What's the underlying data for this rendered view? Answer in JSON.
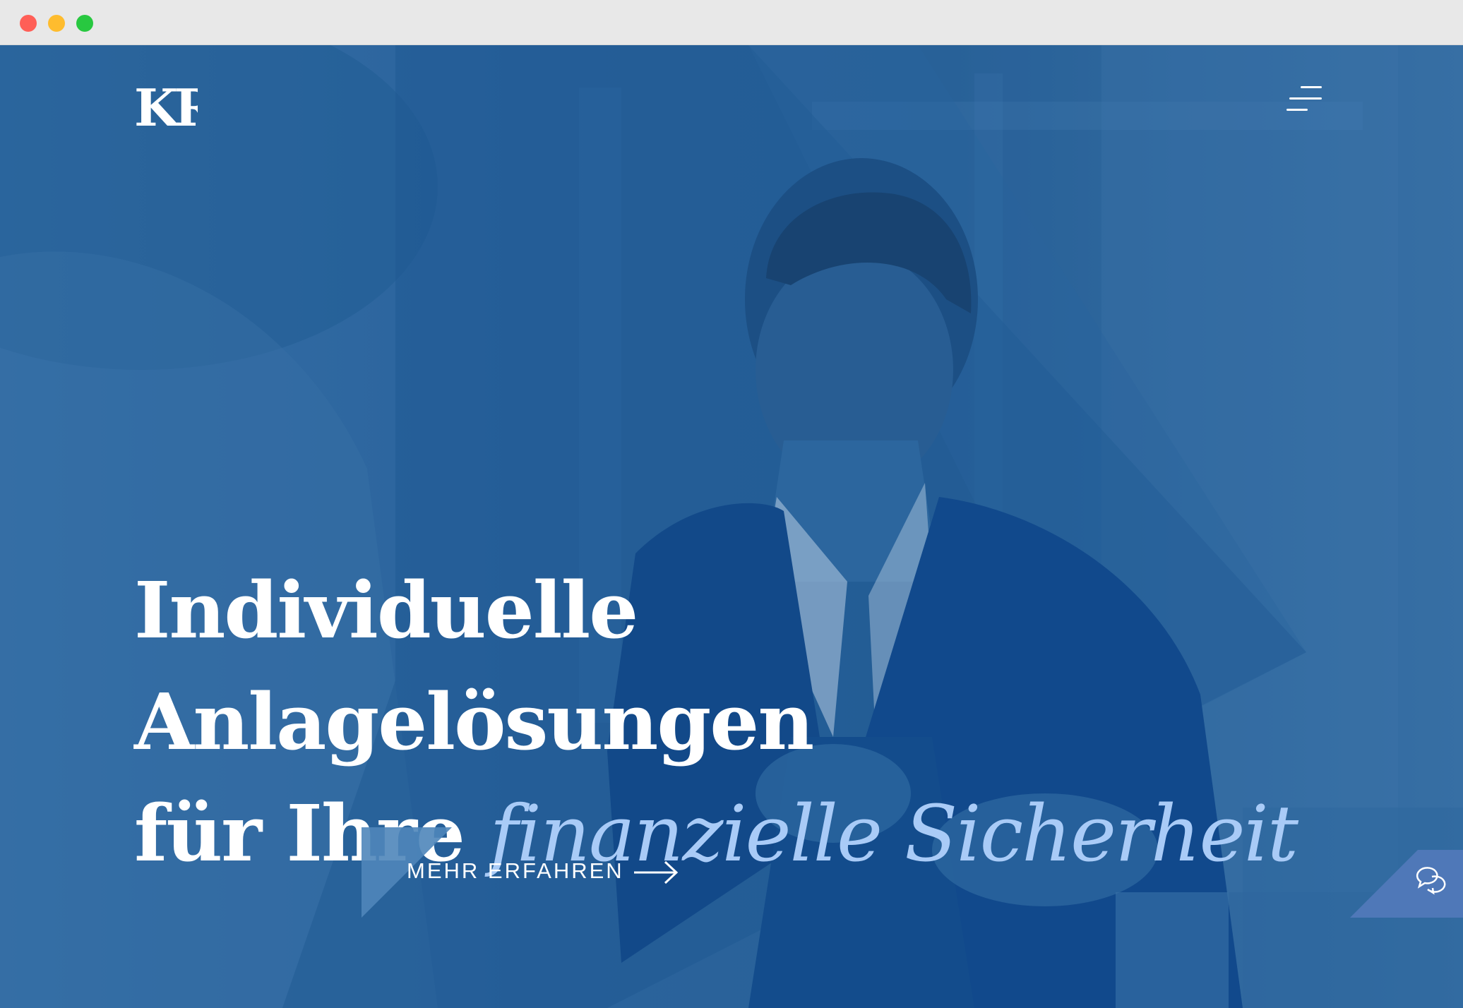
{
  "browser": {
    "window_controls": [
      "close",
      "minimize",
      "maximize"
    ]
  },
  "header": {
    "logo_text": "KR",
    "menu_icon": "menu-icon"
  },
  "hero": {
    "headline_line1": "Individuelle Anlagelösungen",
    "headline_line2_plain": "für Ihre",
    "headline_line2_accent": "finanzielle Sicherheit",
    "cta_label": "MEHR ERFAHREN",
    "cta_icon": "arrow-right-icon",
    "chat_icon": "chat-bubbles-icon"
  },
  "colors": {
    "overlay_blue": "#245f98",
    "accent_light_blue": "#a9cbf7",
    "chat_button": "#4f78b8",
    "cta_triangle": "#4f86ba",
    "text_white": "#ffffff"
  }
}
